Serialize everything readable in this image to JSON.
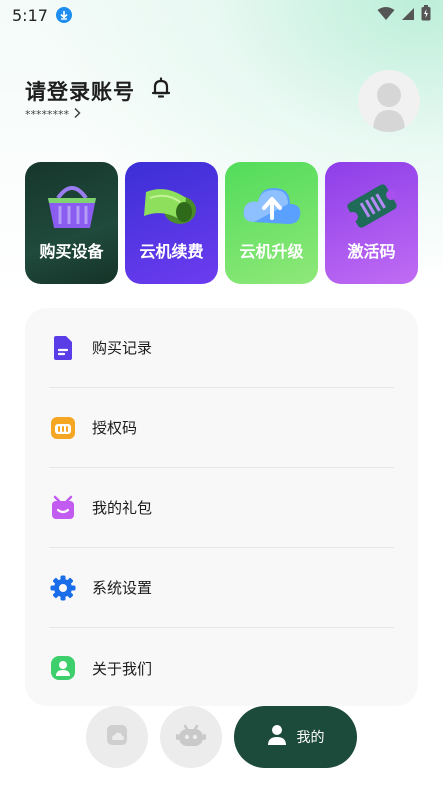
{
  "status_bar": {
    "time": "5:17",
    "icons": [
      "download-icon",
      "wifi-icon",
      "signal-icon",
      "battery-icon"
    ]
  },
  "header": {
    "title": "请登录账号",
    "account_masked": "********",
    "icons": [
      "bell-icon",
      "chevron-right-icon",
      "avatar-placeholder"
    ]
  },
  "cards": [
    {
      "label": "购买设备",
      "icon": "shopping-basket-icon",
      "color": "#1f4a3c"
    },
    {
      "label": "云机续费",
      "icon": "cash-roll-icon",
      "color": "#4b32e0"
    },
    {
      "label": "云机升级",
      "icon": "cloud-upgrade-icon",
      "color": "#63e065"
    },
    {
      "label": "激活码",
      "icon": "ticket-icon",
      "color": "#a850ee"
    }
  ],
  "menu": [
    {
      "label": "购买记录",
      "icon": "document-icon",
      "color": "#5b3de8"
    },
    {
      "label": "授权码",
      "icon": "key-card-icon",
      "color": "#f5a623"
    },
    {
      "label": "我的礼包",
      "icon": "gift-icon",
      "color": "#c25cf0"
    },
    {
      "label": "系统设置",
      "icon": "gear-icon",
      "color": "#1a6de8"
    },
    {
      "label": "关于我们",
      "icon": "user-badge-icon",
      "color": "#3dcf6c"
    }
  ],
  "bottom_nav": {
    "items": [
      "home-icon",
      "robot-icon"
    ],
    "active_label": "我的",
    "active_color": "#1c4a3b"
  }
}
